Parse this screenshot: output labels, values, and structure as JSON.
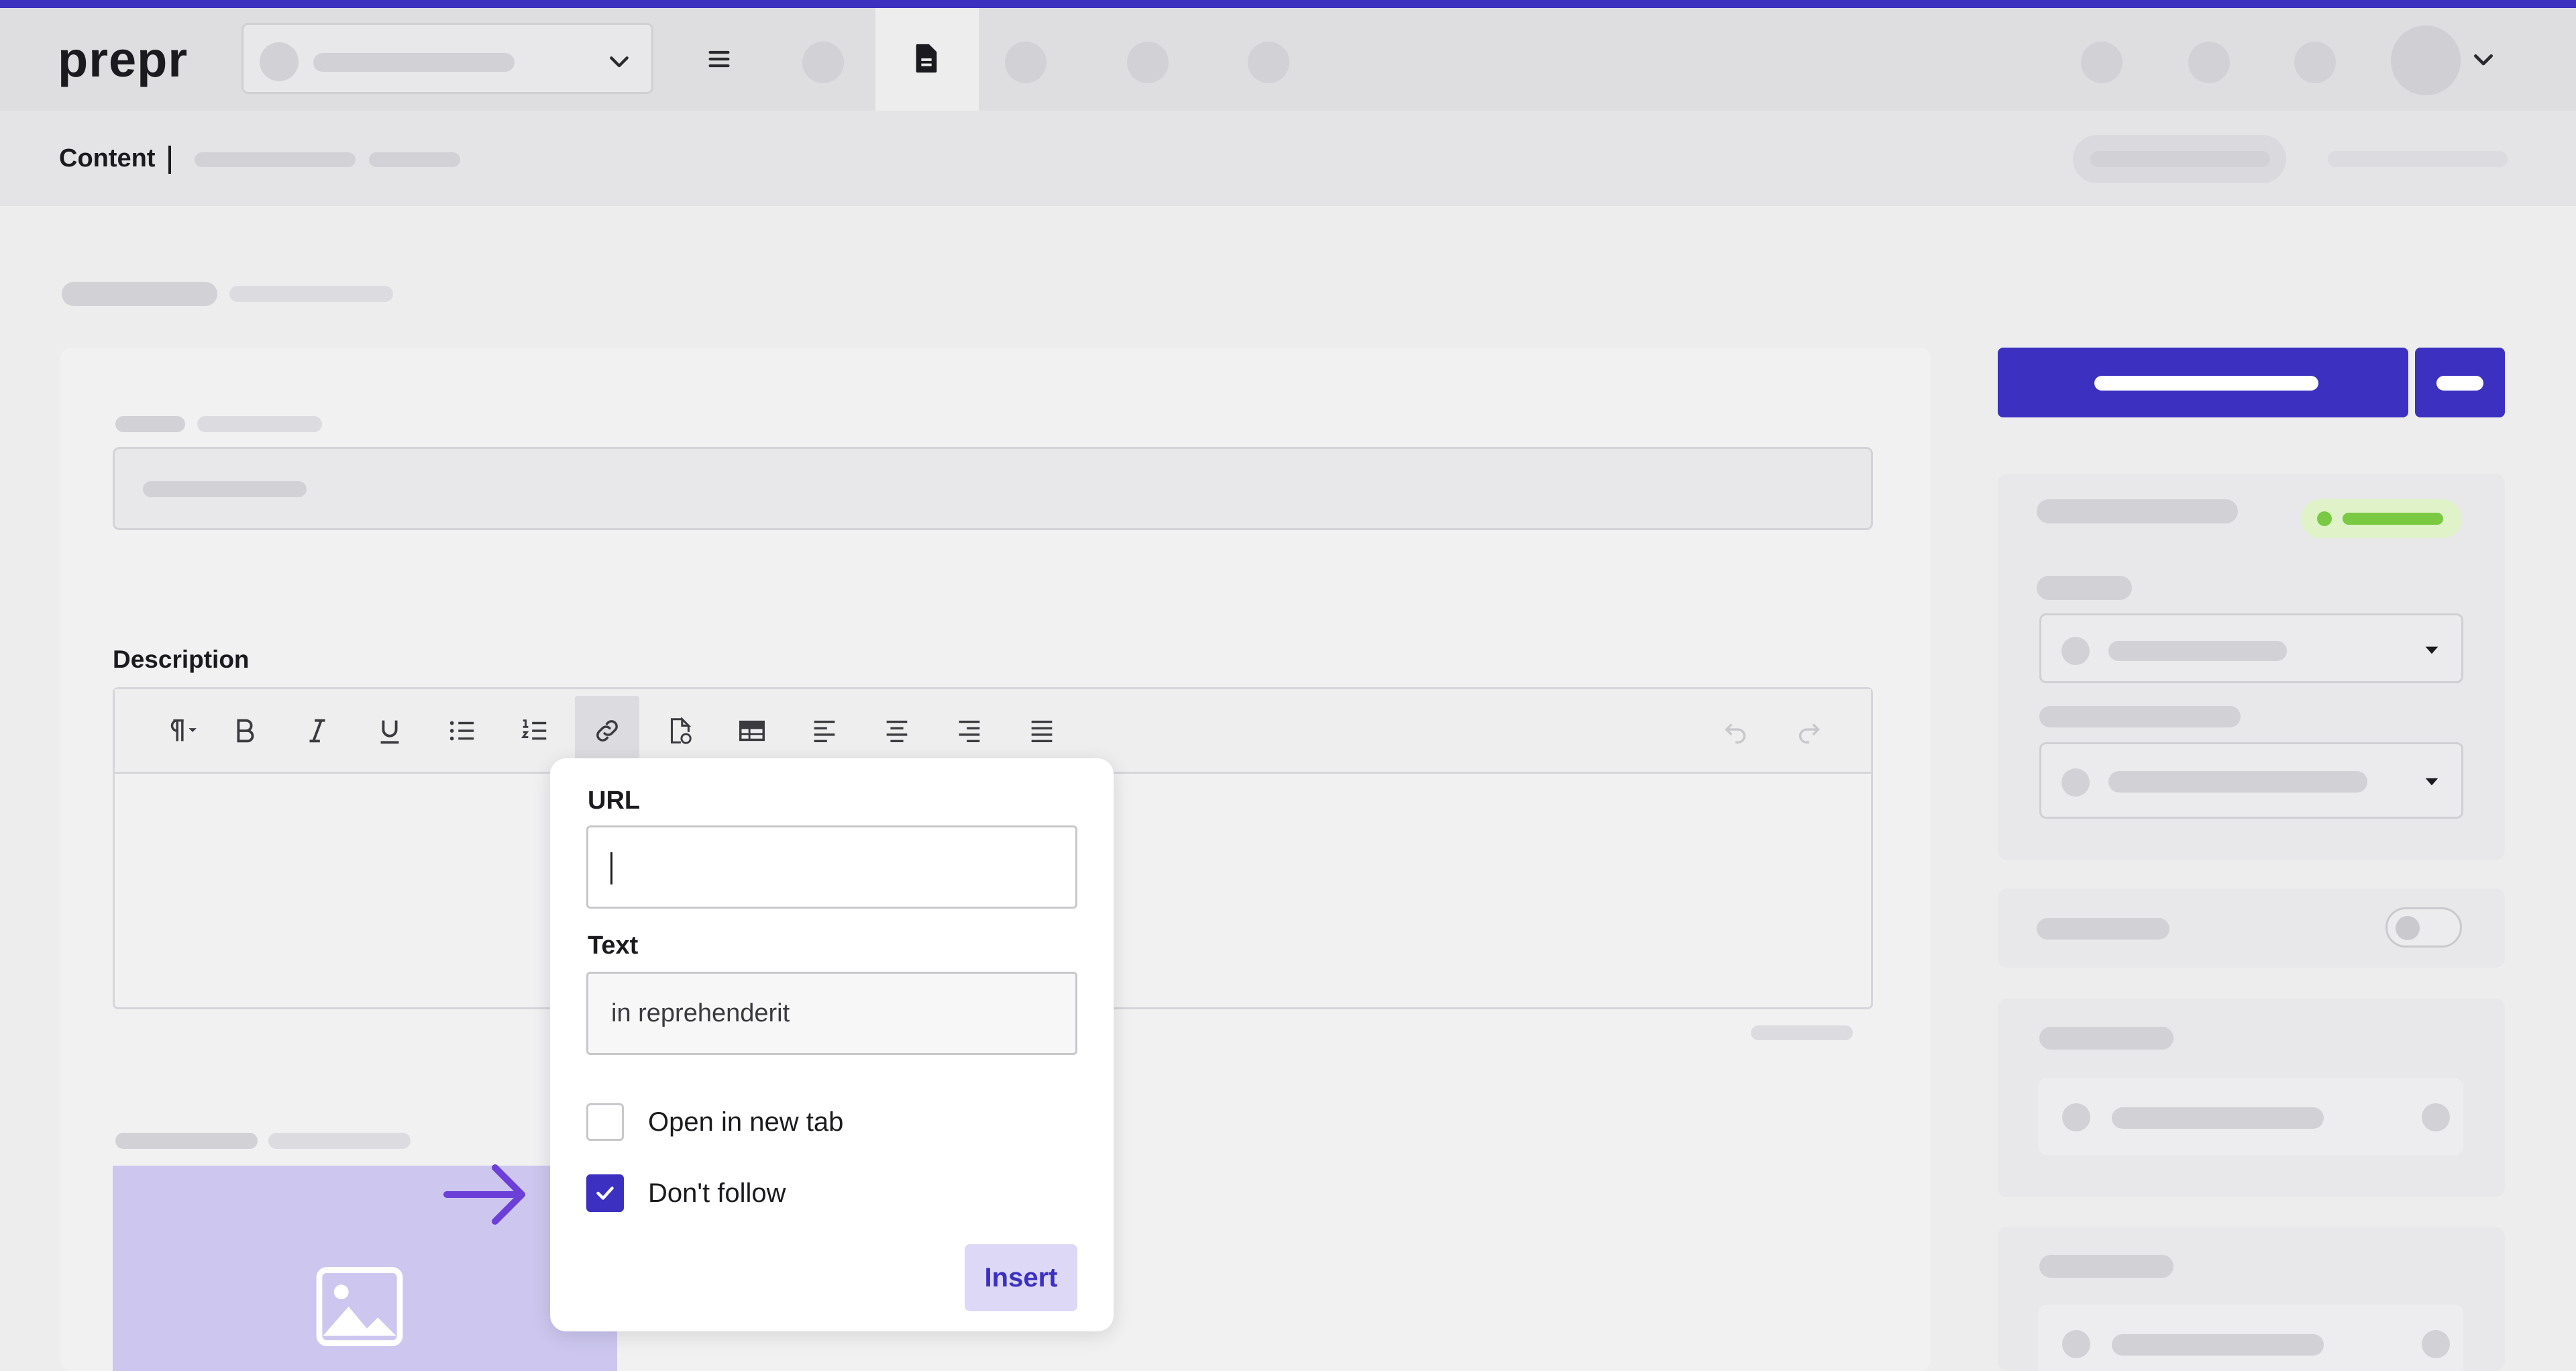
{
  "app": {
    "logo": "prepr"
  },
  "breadcrumb": {
    "section": "Content"
  },
  "form": {
    "description_label": "Description"
  },
  "editor": {
    "toolbar": [
      {
        "name": "paragraph-format-icon"
      },
      {
        "name": "bold-icon"
      },
      {
        "name": "italic-icon"
      },
      {
        "name": "underline-icon"
      },
      {
        "name": "bullet-list-icon"
      },
      {
        "name": "numbered-list-icon"
      },
      {
        "name": "link-icon",
        "active": true
      },
      {
        "name": "insert-file-icon"
      },
      {
        "name": "table-icon"
      },
      {
        "name": "align-left-icon"
      },
      {
        "name": "align-center-icon"
      },
      {
        "name": "align-right-icon"
      },
      {
        "name": "align-justify-icon"
      },
      {
        "name": "undo-icon"
      },
      {
        "name": "redo-icon"
      }
    ]
  },
  "link_popup": {
    "url_label": "URL",
    "url_value": "",
    "text_label": "Text",
    "text_value": "in reprehenderit",
    "open_new_tab_label": "Open in new tab",
    "open_new_tab_checked": false,
    "dont_follow_label": "Don't follow",
    "dont_follow_checked": true,
    "insert_label": "Insert"
  },
  "colors": {
    "accent": "#3b30c0",
    "status_green": "#7ac943",
    "arrow": "#6b3fd8"
  }
}
